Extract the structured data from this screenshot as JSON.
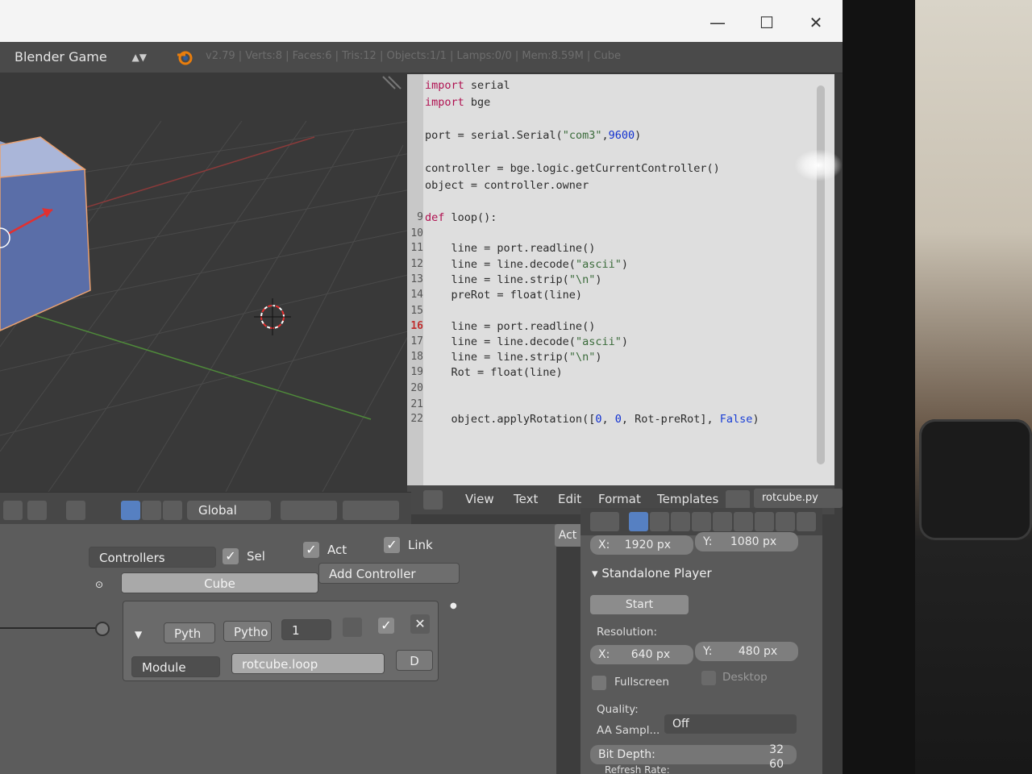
{
  "window": {
    "minimize": "—",
    "maximize": "☐",
    "close": "✕"
  },
  "menubar": {
    "engine": "Blender Game",
    "stats": "v2.79 | Verts:8 | Faces:6 | Tris:12 | Objects:1/1 | Lamps:0/0 | Mem:8.59M | Cube"
  },
  "code_lines": [
    {
      "n": "",
      "text": [
        [
          "kw",
          "import"
        ],
        [
          "",
          "serial"
        ]
      ]
    },
    {
      "n": "",
      "text": [
        [
          "kw",
          "import"
        ],
        [
          "",
          "bge"
        ]
      ]
    },
    {
      "n": "",
      "text": []
    },
    {
      "n": "",
      "text": [
        [
          "",
          "port = serial.Serial("
        ],
        [
          "str",
          "\"com3\""
        ],
        [
          "",
          ","
        ],
        [
          "num",
          "9600"
        ],
        [
          "",
          ")"
        ]
      ]
    },
    {
      "n": "",
      "text": []
    },
    {
      "n": "",
      "text": [
        [
          "",
          "controller = bge.logic.getCurrentController()"
        ]
      ]
    },
    {
      "n": "",
      "text": [
        [
          "",
          "object = controller.owner"
        ]
      ]
    },
    {
      "n": "",
      "text": []
    },
    {
      "n": "9",
      "text": [
        [
          "kw",
          "def"
        ],
        [
          "",
          " loop():"
        ]
      ]
    },
    {
      "n": "10",
      "text": []
    },
    {
      "n": "11",
      "text": [
        [
          "",
          "    line = port.readline()"
        ]
      ]
    },
    {
      "n": "12",
      "text": [
        [
          "",
          "    line = line.decode("
        ],
        [
          "str",
          "\"ascii\""
        ],
        [
          "",
          ")"
        ]
      ]
    },
    {
      "n": "13",
      "text": [
        [
          "",
          "    line = line.strip("
        ],
        [
          "str",
          "\"\\n\""
        ],
        [
          "",
          ")"
        ]
      ]
    },
    {
      "n": "14",
      "text": [
        [
          "",
          "    preRot = float(line)"
        ]
      ]
    },
    {
      "n": "15",
      "text": []
    },
    {
      "n": "16",
      "text": [
        [
          "",
          "    line = port.readline()"
        ]
      ]
    },
    {
      "n": "17",
      "text": [
        [
          "",
          "    line = line.decode("
        ],
        [
          "str",
          "\"ascii\""
        ],
        [
          "",
          ")"
        ]
      ]
    },
    {
      "n": "18",
      "text": [
        [
          "",
          "    line = line.strip("
        ],
        [
          "str",
          "\"\\n\""
        ],
        [
          "",
          ")"
        ]
      ]
    },
    {
      "n": "19",
      "text": [
        [
          "",
          "    Rot = float(line)"
        ]
      ]
    },
    {
      "n": "20",
      "text": []
    },
    {
      "n": "21",
      "text": []
    },
    {
      "n": "22",
      "text": [
        [
          "",
          "    object.applyRotation(["
        ],
        [
          "num",
          "0"
        ],
        [
          "",
          ", "
        ],
        [
          "num",
          "0"
        ],
        [
          "",
          ", Rot-preRot], "
        ],
        [
          "kw2",
          "False"
        ],
        [
          "",
          ")"
        ]
      ]
    }
  ],
  "active_line": "16",
  "text_editor_header": {
    "view": "View",
    "text": "Text",
    "edit": "Edit",
    "format": "Format",
    "templates": "Templates",
    "file": "rotcube.py"
  },
  "viewport_header": {
    "orientation": "Global"
  },
  "logic": {
    "controllers_label": "Controllers",
    "sel": "Sel",
    "act": "Act",
    "link": "Link",
    "object": "Cube",
    "add_controller": "Add Controller",
    "ctrl_type": "Pyth",
    "ctrl_name": "Pytho",
    "ctrl_priority": "1",
    "mode": "Module",
    "module": "rotcube.loop",
    "debug": "D",
    "act_tab": "Act"
  },
  "properties": {
    "res_x_label": "X:",
    "res_x": "1920 px",
    "res_y_label": "Y:",
    "res_y": "1080 px",
    "standalone_title": "Standalone Player",
    "start": "Start",
    "resolution_label": "Resolution:",
    "win_x_label": "X:",
    "win_x": "640 px",
    "win_y_label": "Y:",
    "win_y": "480 px",
    "fullscreen": "Fullscreen",
    "desktop": "Desktop",
    "quality_label": "Quality:",
    "aa_label": "AA Sampl...",
    "aa_value": "Off",
    "bit_depth_label": "Bit Depth:",
    "bit_depth": "32",
    "refresh_label": "Refresh Rate:",
    "refresh": "60"
  }
}
